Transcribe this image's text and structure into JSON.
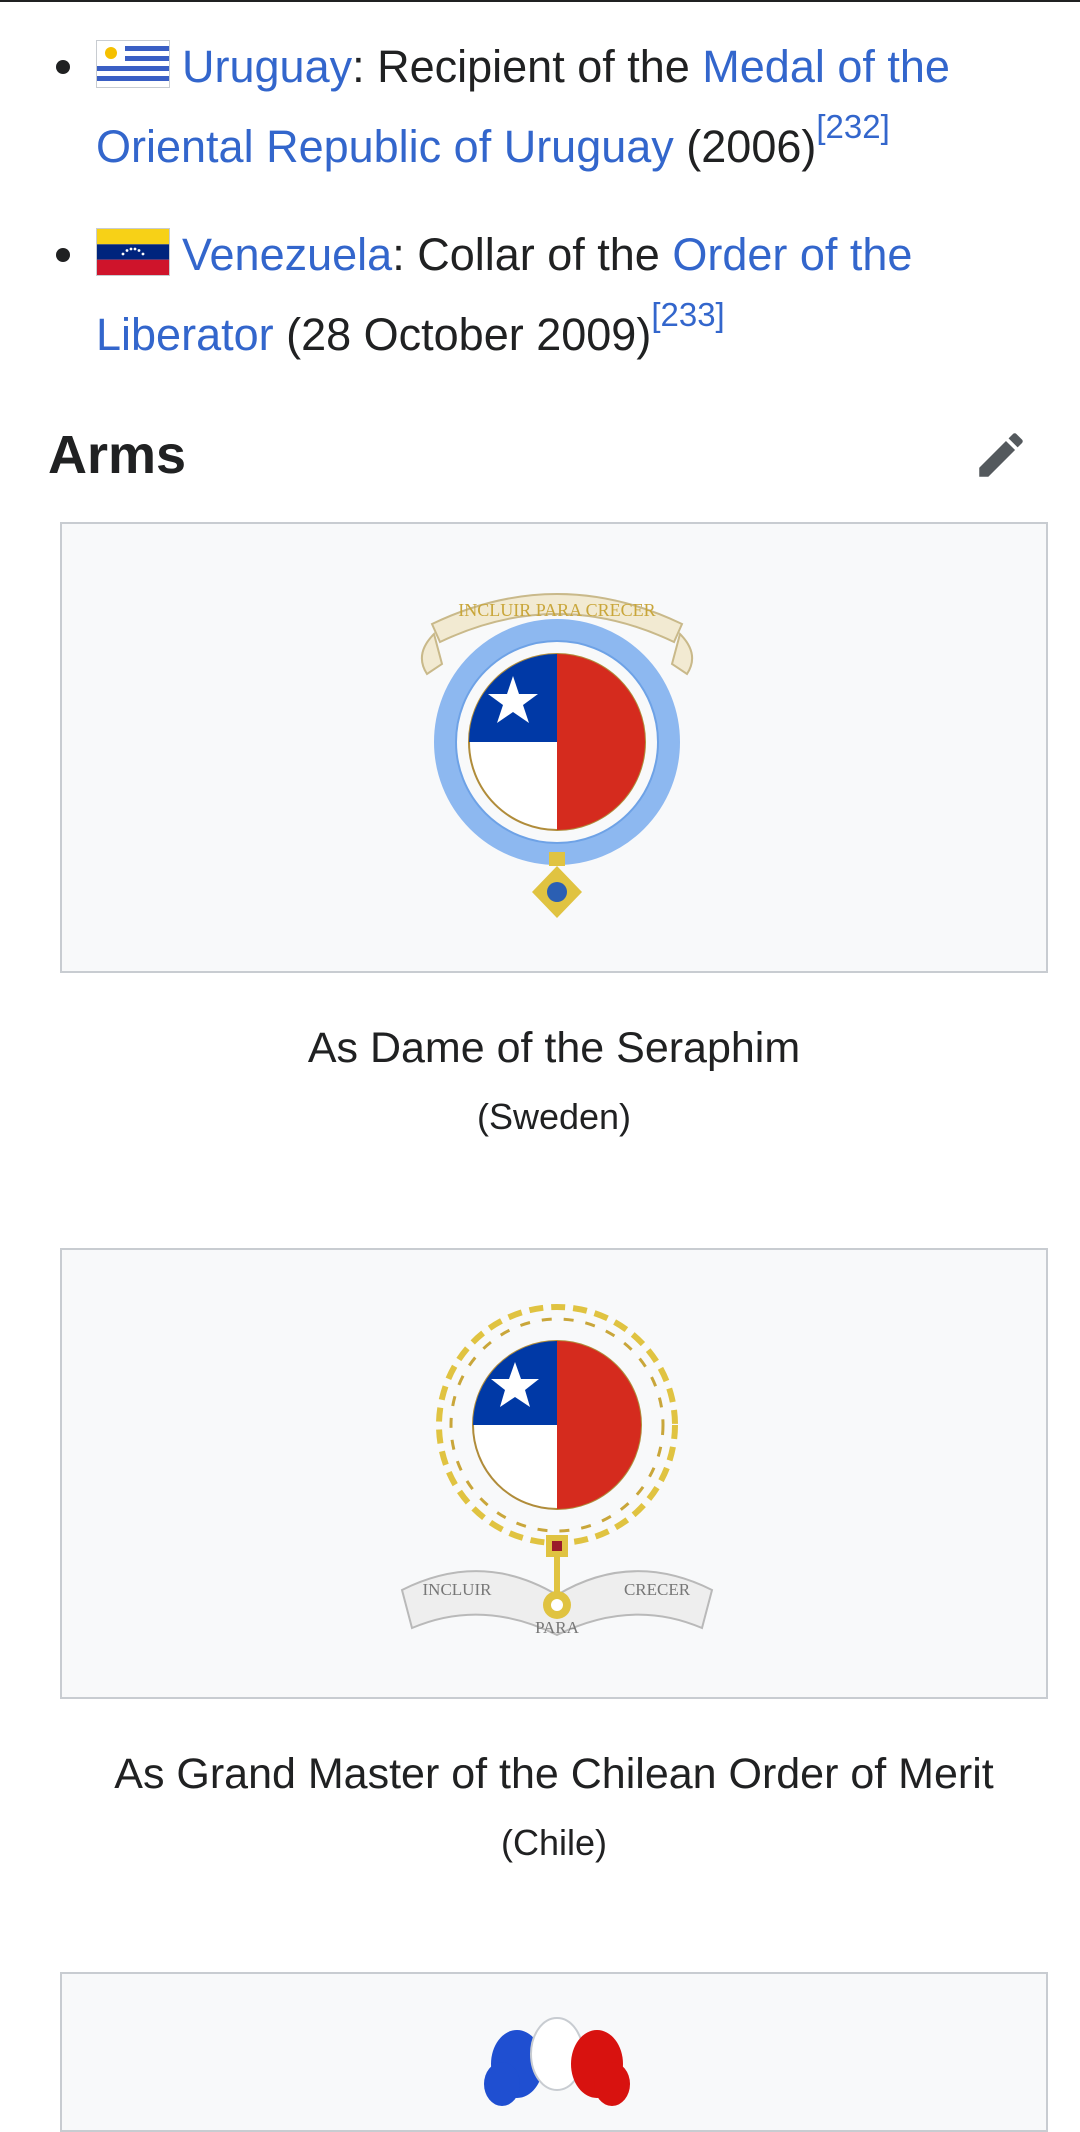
{
  "honours": [
    {
      "country": "Uruguay",
      "flag": "uruguay-flag",
      "sep": ": Recipient of the ",
      "award": "Medal of the Oriental Republic of Uruguay",
      "after": " (2006)",
      "ref": "[232]"
    },
    {
      "country": "Venezuela",
      "flag": "venezuela-flag",
      "sep": ": Collar of the ",
      "award": "Order of the Liberator",
      "after": " (28 October 2009)",
      "ref": "[233]"
    }
  ],
  "section": {
    "title": "Arms",
    "edit_icon": "pencil-icon"
  },
  "gallery": [
    {
      "image_alt": "Chilean coat of arms encircled by the Seraphim riband",
      "scroll_text": "INCLUIR PARA CRECER",
      "caption": "As Dame of the Seraphim",
      "subcaption": "(Sweden)"
    },
    {
      "image_alt": "Chilean coat of arms with gold collar of the Order of Merit",
      "scroll_left": "INCLUIR",
      "scroll_center": "PARA",
      "scroll_right": "CRECER",
      "caption": "As Grand Master of the Chilean Order of Merit",
      "subcaption": "(Chile)"
    },
    {
      "image_alt": "Plumes of red, white and blue"
    }
  ],
  "colors": {
    "link": "#3366cc",
    "text": "#202122",
    "chile_red": "#d52b1e",
    "chile_blue": "#0039a6",
    "seraphim_blue": "#8db8f0",
    "gold": "#e0c341"
  }
}
